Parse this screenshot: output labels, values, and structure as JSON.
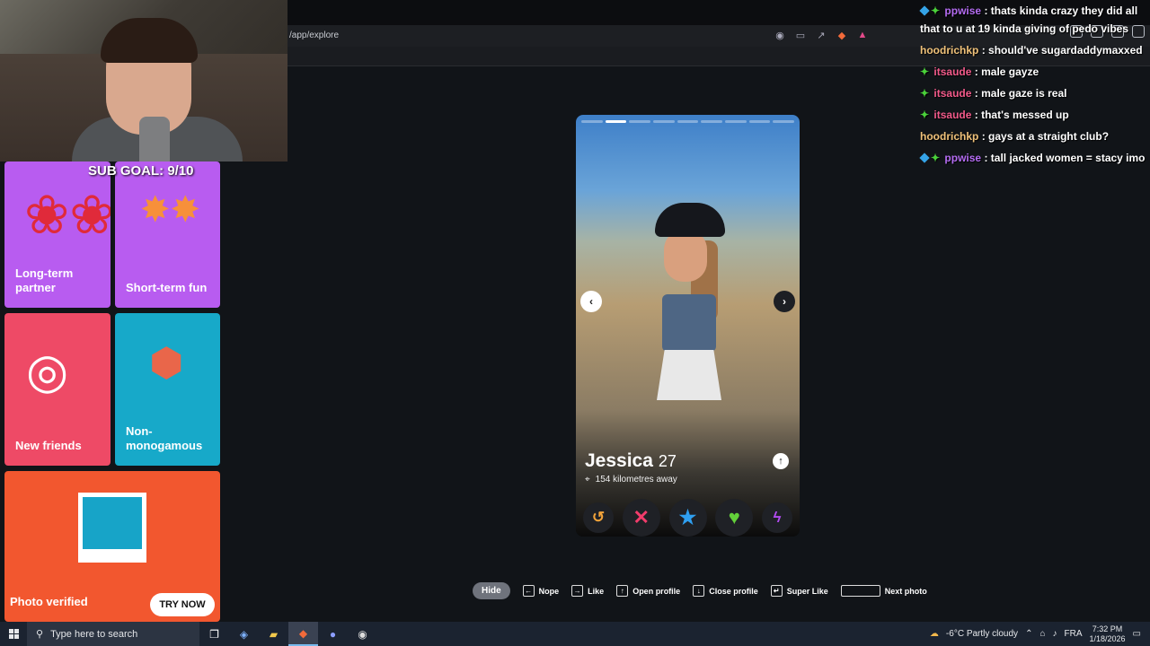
{
  "browser": {
    "url": "/app/explore"
  },
  "overlay": {
    "sub_goal": "SUB GOAL: 9/10"
  },
  "intent_tiles": [
    {
      "label": "Long-term partner",
      "color": "#b85cf0",
      "icon": "roses-icon"
    },
    {
      "label": "Short-term fun",
      "color": "#b85cf0",
      "icon": "sparklers-icon"
    },
    {
      "label": "New friends",
      "color": "#ee4a66",
      "icon": "bracelets-icon"
    },
    {
      "label": "Non-monogamous",
      "color": "#17a9c9",
      "icon": "pineapple-icon"
    }
  ],
  "verified_tile": {
    "label": "Photo verified",
    "button": "TRY NOW",
    "color": "#f2572f"
  },
  "profile": {
    "name": "Jessica",
    "age": "27",
    "distance": "154 kilometres away",
    "photo_count": 9,
    "active_photo": 2
  },
  "actions": [
    {
      "name": "rewind-button",
      "glyph": "↺",
      "color": "#f2a33a"
    },
    {
      "name": "nope-button",
      "glyph": "✕",
      "color": "#f23c6b"
    },
    {
      "name": "super-like-button",
      "glyph": "★",
      "color": "#2f9ff0"
    },
    {
      "name": "like-button",
      "glyph": "♥",
      "color": "#63d13a"
    },
    {
      "name": "boost-button",
      "glyph": "ϟ",
      "color": "#b34bf2"
    }
  ],
  "shortcuts": {
    "hide": "Hide",
    "nope": "Nope",
    "like": "Like",
    "open_profile": "Open profile",
    "close_profile": "Close profile",
    "super_like": "Super Like",
    "next_photo": "Next photo"
  },
  "chat": [
    {
      "user": "ppwise",
      "color": "#b46cf2",
      "badges": true,
      "text": ": thats kinda crazy they did all that to u at 19 kinda giving of pedo vibes"
    },
    {
      "user": "hoodrichkp",
      "color": "#f0c27a",
      "badges": false,
      "text": ": should've sugardaddymaxxed"
    },
    {
      "user": "itsaude",
      "color": "#f25a8a",
      "badges": true,
      "text": ": male gayze"
    },
    {
      "user": "itsaude",
      "color": "#f25a8a",
      "badges": true,
      "text": ": male gaze is real"
    },
    {
      "user": "itsaude",
      "color": "#f25a8a",
      "badges": true,
      "text": ": that's messed up"
    },
    {
      "user": "hoodrichkp",
      "color": "#f0c27a",
      "badges": false,
      "text": ": gays at a straight club?"
    },
    {
      "user": "ppwise",
      "color": "#b46cf2",
      "badges": true,
      "text": ": tall jacked women = stacy imo"
    }
  ],
  "taskbar": {
    "search_placeholder": "Type here to search",
    "weather": "-6°C  Partly cloudy",
    "language": "FRA",
    "time": "7:32 PM",
    "date": "1/18/2026"
  }
}
